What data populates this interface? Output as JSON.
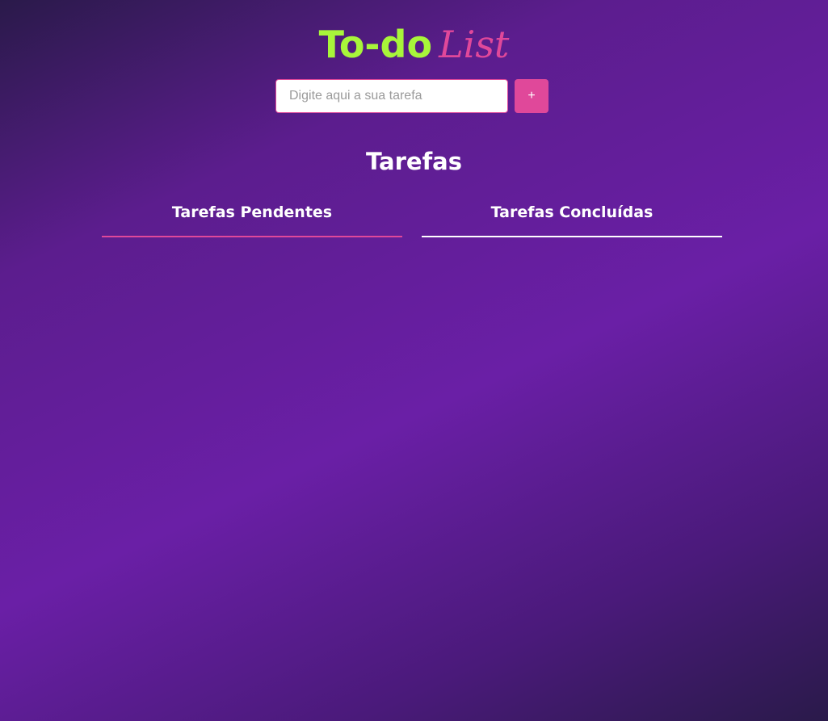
{
  "header": {
    "title_part1": "To-do",
    "title_part2": "List"
  },
  "form": {
    "input_placeholder": "Digite aqui a sua tarefa",
    "add_label": "+"
  },
  "main": {
    "section_title": "Tarefas",
    "tabs": [
      {
        "label": "Tarefas Pendentes",
        "active": true
      },
      {
        "label": "Tarefas Concluídas",
        "active": false
      }
    ]
  },
  "colors": {
    "accent_green": "#a8f53a",
    "accent_pink": "#e0489a",
    "background_purple": "#6a1fa6"
  }
}
